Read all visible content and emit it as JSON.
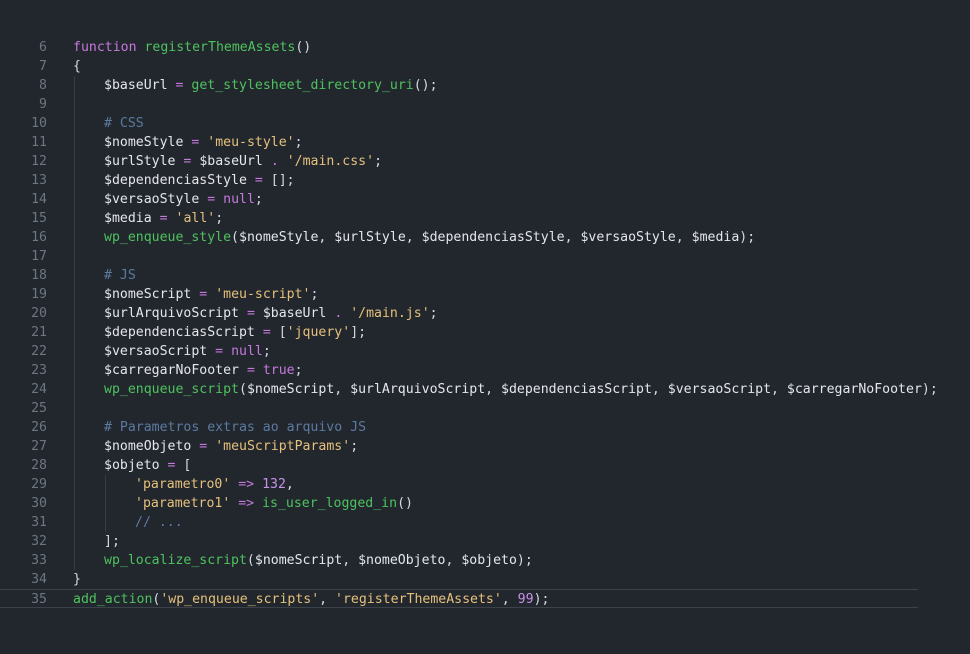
{
  "editor": {
    "colors": {
      "background": "#22272e",
      "line_number": "#6e7681",
      "keyword": "#c678dd",
      "function": "#4ec25e",
      "variable": "#e4e6ea",
      "string": "#e5c07b",
      "comment": "#5c7aa0",
      "number": "#c792ea"
    },
    "lines": [
      {
        "n": "6",
        "indent": 0,
        "tokens": [
          [
            "kw",
            "function"
          ],
          [
            "pun",
            " "
          ],
          [
            "fn",
            "registerThemeAssets"
          ],
          [
            "pun",
            "()"
          ]
        ]
      },
      {
        "n": "7",
        "indent": 0,
        "tokens": [
          [
            "pun",
            "{"
          ]
        ]
      },
      {
        "n": "8",
        "indent": 1,
        "tokens": [
          [
            "var",
            "$baseUrl"
          ],
          [
            "pun",
            " "
          ],
          [
            "op",
            "="
          ],
          [
            "pun",
            " "
          ],
          [
            "fn",
            "get_stylesheet_directory_uri"
          ],
          [
            "pun",
            "();"
          ]
        ]
      },
      {
        "n": "9",
        "indent": 1,
        "tokens": []
      },
      {
        "n": "10",
        "indent": 1,
        "tokens": [
          [
            "com",
            "# CSS"
          ]
        ]
      },
      {
        "n": "11",
        "indent": 1,
        "tokens": [
          [
            "var",
            "$nomeStyle"
          ],
          [
            "pun",
            " "
          ],
          [
            "op",
            "="
          ],
          [
            "pun",
            " "
          ],
          [
            "str",
            "'meu-style'"
          ],
          [
            "pun",
            ";"
          ]
        ]
      },
      {
        "n": "12",
        "indent": 1,
        "tokens": [
          [
            "var",
            "$urlStyle"
          ],
          [
            "pun",
            " "
          ],
          [
            "op",
            "="
          ],
          [
            "pun",
            " "
          ],
          [
            "var",
            "$baseUrl"
          ],
          [
            "pun",
            " "
          ],
          [
            "op",
            "."
          ],
          [
            "pun",
            " "
          ],
          [
            "str",
            "'/main.css'"
          ],
          [
            "pun",
            ";"
          ]
        ]
      },
      {
        "n": "13",
        "indent": 1,
        "tokens": [
          [
            "var",
            "$dependenciasStyle"
          ],
          [
            "pun",
            " "
          ],
          [
            "op",
            "="
          ],
          [
            "pun",
            " [];"
          ]
        ]
      },
      {
        "n": "14",
        "indent": 1,
        "tokens": [
          [
            "var",
            "$versaoStyle"
          ],
          [
            "pun",
            " "
          ],
          [
            "op",
            "="
          ],
          [
            "pun",
            " "
          ],
          [
            "kw",
            "null"
          ],
          [
            "pun",
            ";"
          ]
        ]
      },
      {
        "n": "15",
        "indent": 1,
        "tokens": [
          [
            "var",
            "$media"
          ],
          [
            "pun",
            " "
          ],
          [
            "op",
            "="
          ],
          [
            "pun",
            " "
          ],
          [
            "str",
            "'all'"
          ],
          [
            "pun",
            ";"
          ]
        ]
      },
      {
        "n": "16",
        "indent": 1,
        "tokens": [
          [
            "fn",
            "wp_enqueue_style"
          ],
          [
            "pun",
            "("
          ],
          [
            "var",
            "$nomeStyle"
          ],
          [
            "pun",
            ", "
          ],
          [
            "var",
            "$urlStyle"
          ],
          [
            "pun",
            ", "
          ],
          [
            "var",
            "$dependenciasStyle"
          ],
          [
            "pun",
            ", "
          ],
          [
            "var",
            "$versaoStyle"
          ],
          [
            "pun",
            ", "
          ],
          [
            "var",
            "$media"
          ],
          [
            "pun",
            ");"
          ]
        ]
      },
      {
        "n": "17",
        "indent": 1,
        "tokens": []
      },
      {
        "n": "18",
        "indent": 1,
        "tokens": [
          [
            "com",
            "# JS"
          ]
        ]
      },
      {
        "n": "19",
        "indent": 1,
        "tokens": [
          [
            "var",
            "$nomeScript"
          ],
          [
            "pun",
            " "
          ],
          [
            "op",
            "="
          ],
          [
            "pun",
            " "
          ],
          [
            "str",
            "'meu-script'"
          ],
          [
            "pun",
            ";"
          ]
        ]
      },
      {
        "n": "20",
        "indent": 1,
        "tokens": [
          [
            "var",
            "$urlArquivoScript"
          ],
          [
            "pun",
            " "
          ],
          [
            "op",
            "="
          ],
          [
            "pun",
            " "
          ],
          [
            "var",
            "$baseUrl"
          ],
          [
            "pun",
            " "
          ],
          [
            "op",
            "."
          ],
          [
            "pun",
            " "
          ],
          [
            "str",
            "'/main.js'"
          ],
          [
            "pun",
            ";"
          ]
        ]
      },
      {
        "n": "21",
        "indent": 1,
        "tokens": [
          [
            "var",
            "$dependenciasScript"
          ],
          [
            "pun",
            " "
          ],
          [
            "op",
            "="
          ],
          [
            "pun",
            " ["
          ],
          [
            "str",
            "'jquery'"
          ],
          [
            "pun",
            "];"
          ]
        ]
      },
      {
        "n": "22",
        "indent": 1,
        "tokens": [
          [
            "var",
            "$versaoScript"
          ],
          [
            "pun",
            " "
          ],
          [
            "op",
            "="
          ],
          [
            "pun",
            " "
          ],
          [
            "kw",
            "null"
          ],
          [
            "pun",
            ";"
          ]
        ]
      },
      {
        "n": "23",
        "indent": 1,
        "tokens": [
          [
            "var",
            "$carregarNoFooter"
          ],
          [
            "pun",
            " "
          ],
          [
            "op",
            "="
          ],
          [
            "pun",
            " "
          ],
          [
            "kw",
            "true"
          ],
          [
            "pun",
            ";"
          ]
        ]
      },
      {
        "n": "24",
        "indent": 1,
        "tokens": [
          [
            "fn",
            "wp_enqueue_script"
          ],
          [
            "pun",
            "("
          ],
          [
            "var",
            "$nomeScript"
          ],
          [
            "pun",
            ", "
          ],
          [
            "var",
            "$urlArquivoScript"
          ],
          [
            "pun",
            ", "
          ],
          [
            "var",
            "$dependenciasScript"
          ],
          [
            "pun",
            ", "
          ],
          [
            "var",
            "$versaoScript"
          ],
          [
            "pun",
            ", "
          ],
          [
            "var",
            "$carregarNoFooter"
          ],
          [
            "pun",
            ");"
          ]
        ]
      },
      {
        "n": "25",
        "indent": 1,
        "tokens": []
      },
      {
        "n": "26",
        "indent": 1,
        "tokens": [
          [
            "com",
            "# Parametros extras ao arquivo JS"
          ]
        ]
      },
      {
        "n": "27",
        "indent": 1,
        "tokens": [
          [
            "var",
            "$nomeObjeto"
          ],
          [
            "pun",
            " "
          ],
          [
            "op",
            "="
          ],
          [
            "pun",
            " "
          ],
          [
            "str",
            "'meuScriptParams'"
          ],
          [
            "pun",
            ";"
          ]
        ]
      },
      {
        "n": "28",
        "indent": 1,
        "tokens": [
          [
            "var",
            "$objeto"
          ],
          [
            "pun",
            " "
          ],
          [
            "op",
            "="
          ],
          [
            "pun",
            " ["
          ]
        ]
      },
      {
        "n": "29",
        "indent": 2,
        "tokens": [
          [
            "str",
            "'parametro0'"
          ],
          [
            "pun",
            " "
          ],
          [
            "op",
            "=>"
          ],
          [
            "pun",
            " "
          ],
          [
            "num",
            "132"
          ],
          [
            "pun",
            ","
          ]
        ]
      },
      {
        "n": "30",
        "indent": 2,
        "tokens": [
          [
            "str",
            "'parametro1'"
          ],
          [
            "pun",
            " "
          ],
          [
            "op",
            "=>"
          ],
          [
            "pun",
            " "
          ],
          [
            "fn",
            "is_user_logged_in"
          ],
          [
            "pun",
            "()"
          ]
        ]
      },
      {
        "n": "31",
        "indent": 2,
        "tokens": [
          [
            "com",
            "// ..."
          ]
        ]
      },
      {
        "n": "32",
        "indent": 1,
        "tokens": [
          [
            "pun",
            "];"
          ]
        ]
      },
      {
        "n": "33",
        "indent": 1,
        "tokens": [
          [
            "fn",
            "wp_localize_script"
          ],
          [
            "pun",
            "("
          ],
          [
            "var",
            "$nomeScript"
          ],
          [
            "pun",
            ", "
          ],
          [
            "var",
            "$nomeObjeto"
          ],
          [
            "pun",
            ", "
          ],
          [
            "var",
            "$objeto"
          ],
          [
            "pun",
            ");"
          ]
        ]
      },
      {
        "n": "34",
        "indent": 0,
        "tokens": [
          [
            "pun",
            "}"
          ]
        ]
      },
      {
        "n": "35",
        "indent": 0,
        "current": true,
        "tokens": [
          [
            "fn",
            "add_action"
          ],
          [
            "pun",
            "("
          ],
          [
            "str",
            "'wp_enqueue_scripts'"
          ],
          [
            "pun",
            ", "
          ],
          [
            "str",
            "'registerThemeAssets'"
          ],
          [
            "pun",
            ", "
          ],
          [
            "num",
            "99"
          ],
          [
            "pun",
            ");"
          ]
        ]
      }
    ]
  }
}
